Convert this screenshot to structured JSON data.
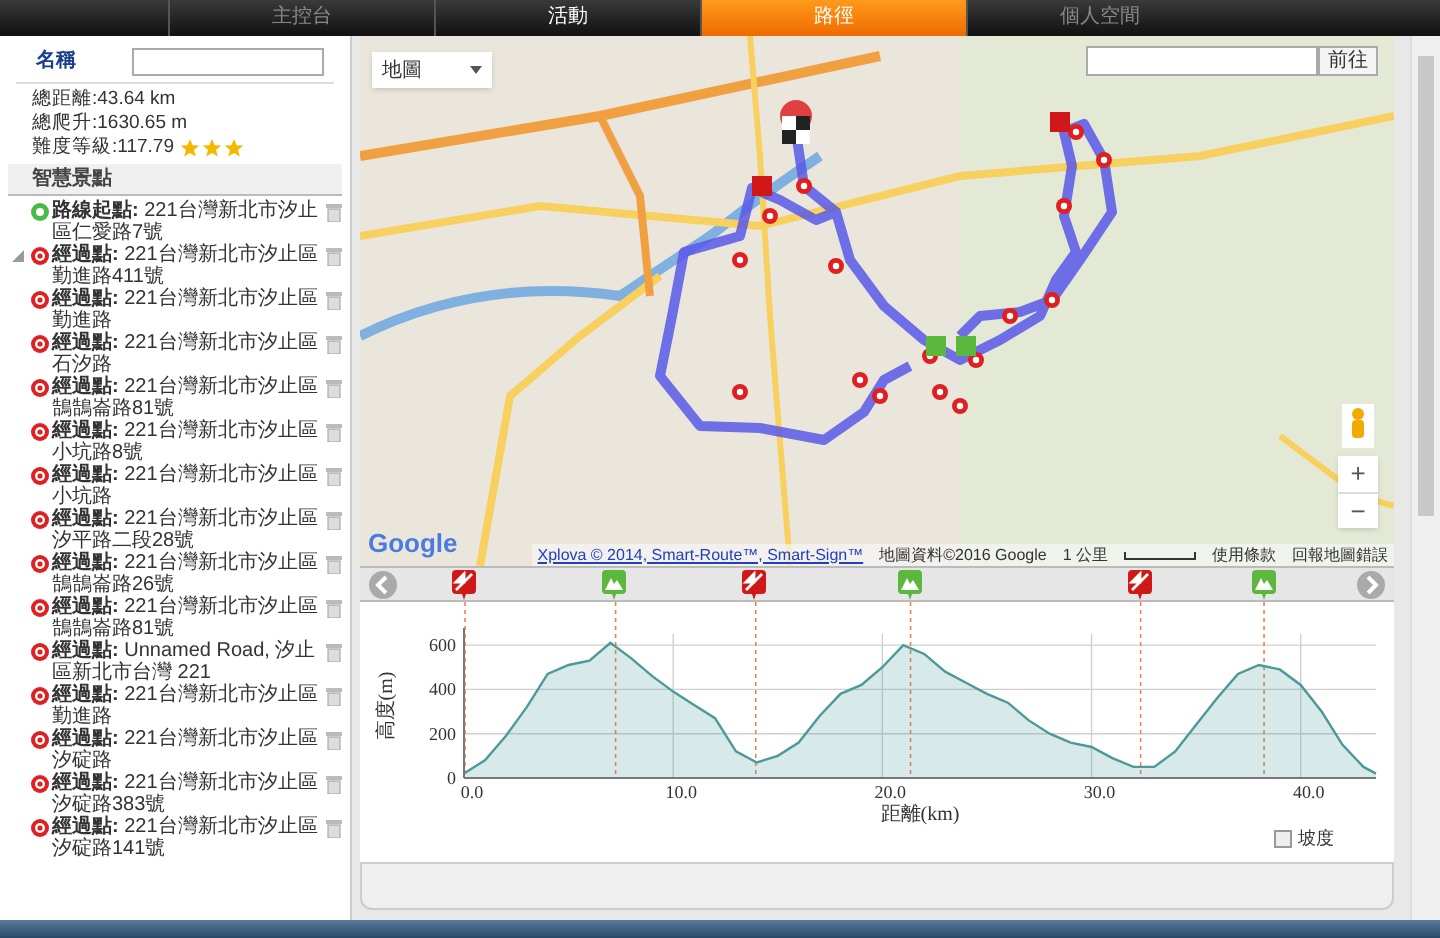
{
  "tabs": [
    {
      "label": "主控台",
      "selected": false
    },
    {
      "label": "活動",
      "selected": false
    },
    {
      "label": "路徑",
      "selected": true
    },
    {
      "label": "個人空間",
      "selected": false
    }
  ],
  "route_info": {
    "name_label": "名稱",
    "distance": "總距離:43.64 km",
    "climb": "總爬升:1630.65 m",
    "difficulty": "難度等級:117.79",
    "stars": 3
  },
  "poi_section": {
    "title": "智慧景點",
    "items": [
      {
        "kind": "start",
        "label": "路線起點:",
        "address": " 221台灣新北市汐止區仁愛路7號",
        "toggle": false
      },
      {
        "kind": "via",
        "label": "經過點:",
        "address": " 221台灣新北市汐止區勤進路411號",
        "toggle": true
      },
      {
        "kind": "via",
        "label": "經過點:",
        "address": " 221台灣新北市汐止區勤進路",
        "toggle": false
      },
      {
        "kind": "via",
        "label": "經過點:",
        "address": " 221台灣新北市汐止區石汐路",
        "toggle": false
      },
      {
        "kind": "via",
        "label": "經過點:",
        "address": " 221台灣新北市汐止區鵠鵠崙路81號",
        "toggle": false
      },
      {
        "kind": "via",
        "label": "經過點:",
        "address": " 221台灣新北市汐止區小坑路8號",
        "toggle": false
      },
      {
        "kind": "via",
        "label": "經過點:",
        "address": " 221台灣新北市汐止區小坑路",
        "toggle": false
      },
      {
        "kind": "via",
        "label": "經過點:",
        "address": " 221台灣新北市汐止區汐平路二段28號",
        "toggle": false
      },
      {
        "kind": "via",
        "label": "經過點:",
        "address": " 221台灣新北市汐止區鵠鵠崙路26號",
        "toggle": false
      },
      {
        "kind": "via",
        "label": "經過點:",
        "address": " 221台灣新北市汐止區鵠鵠崙路81號",
        "toggle": false
      },
      {
        "kind": "via",
        "label": "經過點:",
        "address": " Unnamed Road, 汐止區新北市台灣 221",
        "toggle": false
      },
      {
        "kind": "via",
        "label": "經過點:",
        "address": " 221台灣新北市汐止區勤進路",
        "toggle": false
      },
      {
        "kind": "via",
        "label": "經過點:",
        "address": " 221台灣新北市汐止區汐碇路",
        "toggle": false
      },
      {
        "kind": "via",
        "label": "經過點:",
        "address": " 221台灣新北市汐止區汐碇路383號",
        "toggle": false
      },
      {
        "kind": "via",
        "label": "經過點:",
        "address": " 221台灣新北市汐止區汐碇路141號",
        "toggle": false
      }
    ]
  },
  "map": {
    "map_type": "地圖",
    "go_button": "前往",
    "zoom_in": "+",
    "zoom_out": "−",
    "google_logo": "Google",
    "xplova_link": "Xplova © 2014, Smart-Route™, Smart-Sign™",
    "map_data": "地圖資料©2016 Google",
    "scale": "1 公里",
    "terms": "使用條款",
    "report": "回報地圖錯誤"
  },
  "profile": {
    "markers": [
      {
        "kind": "climb"
      },
      {
        "kind": "summit"
      },
      {
        "kind": "climb"
      },
      {
        "kind": "summit"
      },
      {
        "kind": "climb"
      },
      {
        "kind": "summit"
      }
    ],
    "slope_checkbox": {
      "label": "坡度",
      "checked": false
    },
    "chart_data": {
      "type": "area",
      "xlabel": "距離(km)",
      "ylabel": "高度(m)",
      "x": [
        0,
        1,
        2,
        3,
        4,
        5,
        6,
        7,
        8,
        9,
        10,
        11,
        12,
        13,
        14,
        15,
        16,
        17,
        18,
        19,
        20,
        21,
        22,
        23,
        24,
        25,
        26,
        27,
        28,
        29,
        30,
        31,
        32,
        33,
        34,
        35,
        36,
        37,
        38,
        39,
        40,
        41,
        42,
        43,
        43.6
      ],
      "series": [
        {
          "color": "#4a9a9a",
          "values": [
            20,
            80,
            190,
            320,
            470,
            510,
            530,
            610,
            540,
            460,
            390,
            330,
            270,
            120,
            70,
            100,
            160,
            280,
            380,
            420,
            500,
            600,
            560,
            480,
            430,
            380,
            340,
            260,
            200,
            160,
            140,
            90,
            50,
            50,
            120,
            240,
            360,
            470,
            510,
            490,
            420,
            300,
            150,
            50,
            20
          ]
        }
      ],
      "grid": true,
      "ref_lines": [
        {
          "axis": "x",
          "value": 0,
          "color": "#f08050"
        },
        {
          "axis": "x",
          "value": 7.2,
          "color": "#f08050"
        },
        {
          "axis": "x",
          "value": 13.9,
          "color": "#f08050"
        },
        {
          "axis": "x",
          "value": 21.3,
          "color": "#f08050"
        },
        {
          "axis": "x",
          "value": 32.3,
          "color": "#f08050"
        },
        {
          "axis": "x",
          "value": 38.2,
          "color": "#f08050"
        }
      ],
      "xlim": [
        0,
        43.6
      ],
      "ylim": [
        0,
        650
      ],
      "xticks": [
        {
          "value": 0,
          "label": "0.0"
        },
        {
          "value": 10,
          "label": "10.0"
        },
        {
          "value": 20,
          "label": "20.0"
        },
        {
          "value": 30,
          "label": "30.0"
        },
        {
          "value": 40,
          "label": "40.0"
        }
      ],
      "yticks": [
        0,
        200,
        400,
        600
      ]
    }
  }
}
